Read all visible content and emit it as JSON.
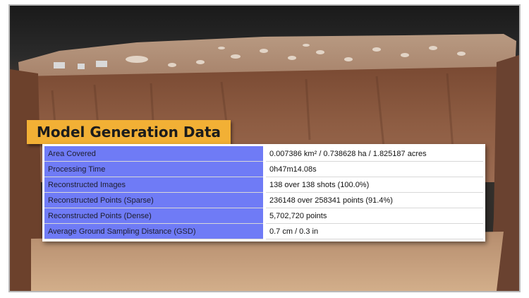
{
  "title": "Model Generation Data",
  "colors": {
    "accent": "#f2b035",
    "key_cell": "#6f7bf6"
  },
  "rows": [
    {
      "label": "Area Covered",
      "value": "0.007386 km² / 0.738628 ha / 1.825187 acres"
    },
    {
      "label": "Processing Time",
      "value": "0h47m14.08s"
    },
    {
      "label": "Reconstructed Images",
      "value": "138 over 138 shots (100.0%)"
    },
    {
      "label": "Reconstructed Points (Sparse)",
      "value": "236148 over 258341 points (91.4%)"
    },
    {
      "label": "Reconstructed Points (Dense)",
      "value": "5,702,720 points"
    },
    {
      "label": "Average Ground Sampling Distance (GSD)",
      "value": "0.7 cm / 0.3 in"
    }
  ]
}
